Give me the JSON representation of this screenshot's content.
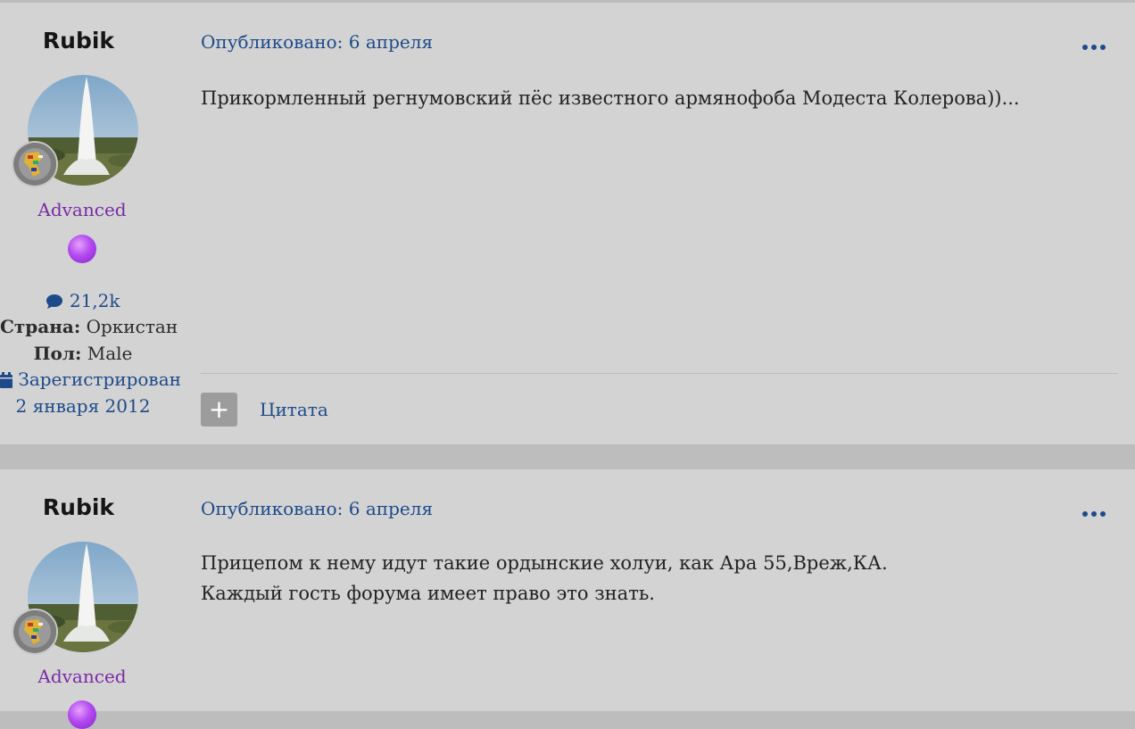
{
  "posts": [
    {
      "author": "Rubik",
      "rank": "Advanced",
      "post_count": "21,2k",
      "country_label": "Страна:",
      "country": "Оркистан",
      "gender_label": "Пол:",
      "gender": "Male",
      "registered_label": "Зарегистрирован",
      "registered_date": "2 января 2012",
      "date": "Опубликовано: 6 апреля",
      "lines": [
        "Прикормленный регнумовский пёс известного армянофоба Модеста Колерова))..."
      ],
      "quote_label": "Цитата",
      "plus_label": "+"
    },
    {
      "author": "Rubik",
      "rank": "Advanced",
      "date": "Опубликовано: 6 апреля",
      "lines": [
        "Прицепом к нему идут такие ордынские холуи, как Ара 55,Вреж,КА.",
        "Каждый гость форума имеет право это знать."
      ]
    }
  ],
  "icons": {
    "menu": "ellipsis-icon",
    "comment": "comment-icon",
    "calendar": "calendar-icon"
  },
  "colors": {
    "link": "#1d4a8a",
    "rank": "#7a2aa6",
    "post_bg": "#d3d3d3",
    "page_bg": "#bdbdbd"
  }
}
